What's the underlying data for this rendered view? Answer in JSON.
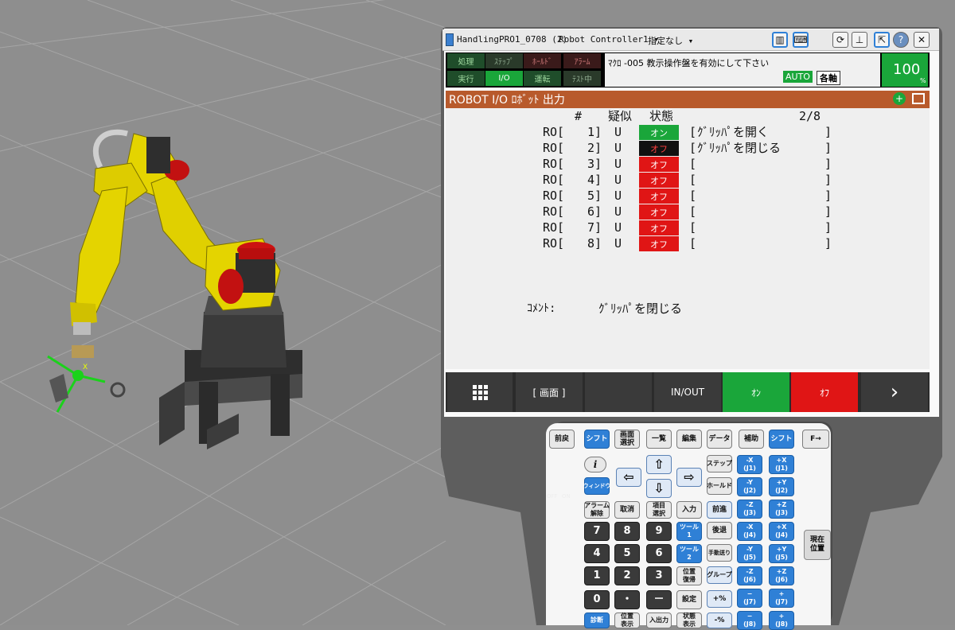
{
  "window": {
    "title": "HandlingPRO1_0708 (2)",
    "controller": "Robot Controller1",
    "target": "指定なし"
  },
  "status": {
    "row1": [
      "処理",
      "ｽﾃｯﾌﾟ",
      "ﾎｰﾙﾄﾞ",
      "ｱﾗｰﾑ"
    ],
    "row2": [
      "実行",
      "I/O",
      "運転",
      "ﾃｽﾄ中"
    ],
    "message": "ﾏｸﾛ -005 教示操作盤を有効にして下さい",
    "mode": "AUTO",
    "coord": "各軸",
    "override": "100",
    "override_unit": "%",
    "colors": {
      "active": "#1aa63a",
      "inactive_dark": "#2a3a2a",
      "alarm": "#3a1a1a"
    }
  },
  "screen": {
    "title": "ROBOT I/O ﾛﾎﾞｯﾄ 出力",
    "col_hash": "#",
    "col_sim": "疑似",
    "col_state": "状態",
    "page": "2/8",
    "rows": [
      {
        "name": "RO[",
        "num": "1]",
        "sim": "U",
        "state": "オン",
        "state_kind": "on",
        "lbr": "[",
        "comment": "ｸﾞﾘｯﾊﾟを開く",
        "rbr": "]"
      },
      {
        "name": "RO[",
        "num": "2]",
        "sim": "U",
        "state": "オフ",
        "state_kind": "sel",
        "lbr": "[",
        "comment": "ｸﾞﾘｯﾊﾟを閉じる",
        "rbr": "]"
      },
      {
        "name": "RO[",
        "num": "3]",
        "sim": "U",
        "state": "オフ",
        "state_kind": "off",
        "lbr": "[",
        "comment": "",
        "rbr": "]"
      },
      {
        "name": "RO[",
        "num": "4]",
        "sim": "U",
        "state": "オフ",
        "state_kind": "off",
        "lbr": "[",
        "comment": "",
        "rbr": "]"
      },
      {
        "name": "RO[",
        "num": "5]",
        "sim": "U",
        "state": "オフ",
        "state_kind": "off",
        "lbr": "[",
        "comment": "",
        "rbr": "]"
      },
      {
        "name": "RO[",
        "num": "6]",
        "sim": "U",
        "state": "オフ",
        "state_kind": "off",
        "lbr": "[",
        "comment": "",
        "rbr": "]"
      },
      {
        "name": "RO[",
        "num": "7]",
        "sim": "U",
        "state": "オフ",
        "state_kind": "off",
        "lbr": "[",
        "comment": "",
        "rbr": "]"
      },
      {
        "name": "RO[",
        "num": "8]",
        "sim": "U",
        "state": "オフ",
        "state_kind": "off",
        "lbr": "[",
        "comment": "",
        "rbr": "]"
      }
    ],
    "comment_label": "ｺﾒﾝﾄ:",
    "comment_value": "ｸﾞﾘｯﾊﾟを閉じる"
  },
  "fkeys": {
    "menu_icon": "grid-icon",
    "f1": "[ 画面 ]",
    "f2": "",
    "f3": "IN/OUT",
    "f4": "ｵﾝ",
    "f5": "ｵﾌ",
    "next_icon": "chevron-right-icon"
  },
  "keypad": {
    "row0": [
      "前戻",
      "シフト",
      "画面\n選択",
      "一覧",
      "編集",
      "データ",
      "補助",
      "シフト",
      "F→"
    ],
    "info": "i",
    "window": "ウィンドウ",
    "step": "ステップ",
    "hold": "ホールド",
    "alarm_reset": "アラーム\n解除",
    "cancel": "取消",
    "item_select": "項目\n選択",
    "enter": "入力",
    "forward": "前進",
    "backward": "後退",
    "seven": "7",
    "eight": "8",
    "nine": "9",
    "four": "4",
    "five": "5",
    "six": "6",
    "one": "1",
    "two": "2",
    "three": "3",
    "zero": "0",
    "dot": "・",
    "minus": "－",
    "tool1": "ツール\n1",
    "tool2": "ツール\n2",
    "manual_feed": "手動送り",
    "group": "グループ",
    "pos_restore": "位置\n復帰",
    "setup": "設定",
    "ovr_up": "+%",
    "ovr_down": "-%",
    "diag": "診断",
    "pos_display": "位置\n表示",
    "io": "入出力",
    "state_display": "状態\n表示",
    "jog_minus": [
      "-X\n(J1)",
      "-Y\n(J2)",
      "-Z\n(J3)",
      "-X\n(J4)",
      "-Y\n(J5)",
      "-Z\n(J6)",
      "−\n(J7)",
      "−\n(J8)"
    ],
    "jog_plus": [
      "+X\n(J1)",
      "+Y\n(J2)",
      "+Z\n(J3)",
      "+X\n(J4)",
      "+Y\n(J5)",
      "+Z\n(J6)",
      "+\n(J7)",
      "+\n(J8)"
    ],
    "current_pos": "現在\n位置",
    "switch_off": "OFF",
    "switch_on": "ON"
  },
  "scene": {
    "triad_label": "X"
  }
}
